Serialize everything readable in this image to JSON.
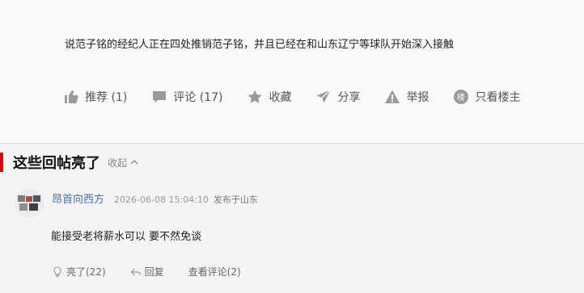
{
  "post": {
    "text": "说范子铭的经纪人正在四处推销范子铭，并且已经在和山东辽宁等球队开始深入接触"
  },
  "actions": {
    "recommend": "推荐 (1)",
    "comment": "评论 (17)",
    "favorite": "收藏",
    "share": "分享",
    "report": "举报",
    "author_only": "只看楼主",
    "author_badge": "楼"
  },
  "hot_replies": {
    "title": "这些回帖亮了",
    "collapse_label": "收起"
  },
  "comment": {
    "username": "昂首向西方",
    "timestamp": "2026-06-08 15:04:10",
    "location": "发布于山东",
    "text": "能接受老将薪水可以 要不然免谈",
    "like_label": "亮了(22)",
    "reply_label": "回复",
    "view_comments_label": "查看评论(2)"
  },
  "colors": {
    "accent_red": "#d7000f",
    "username_blue": "#4a6fa5",
    "icon_gray": "#9a9a9a"
  }
}
